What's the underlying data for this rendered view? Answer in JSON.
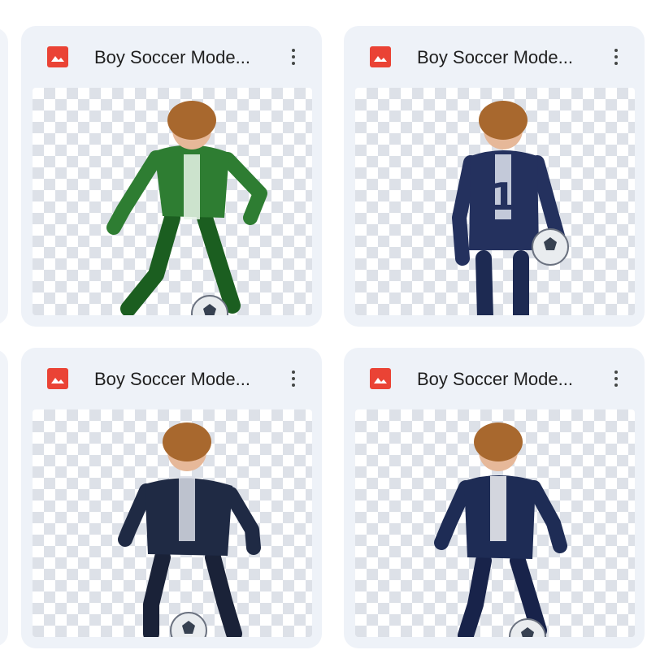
{
  "files": [
    {
      "name": "Boy Soccer Mode...",
      "icon": "image-file-icon",
      "jersey": "#2e7d32",
      "stripe": "#e8f5e9",
      "shorts": "#1b5e20",
      "pose": "front-kick"
    },
    {
      "name": "Boy Soccer Mode...",
      "icon": "image-file-icon",
      "jersey": "#24315e",
      "stripe": "#dfe4ee",
      "shorts": "#1d2a52",
      "pose": "back-ball",
      "back_number": "1"
    },
    {
      "name": "Boy Soccer Mode...",
      "icon": "image-file-icon",
      "jersey": "#1f2a44",
      "stripe": "#d9dde6",
      "shorts": "#1a2238",
      "pose": "front-crouch"
    },
    {
      "name": "Boy Soccer Mode...",
      "icon": "image-file-icon",
      "jersey": "#1e2c55",
      "stripe": "#f3f4f7",
      "shorts": "#18234a",
      "pose": "front-run"
    }
  ],
  "colors": {
    "file_icon": "#ea4335",
    "hair": "#a8682e",
    "skin": "#e6b899",
    "ball": "#e9ecef"
  }
}
